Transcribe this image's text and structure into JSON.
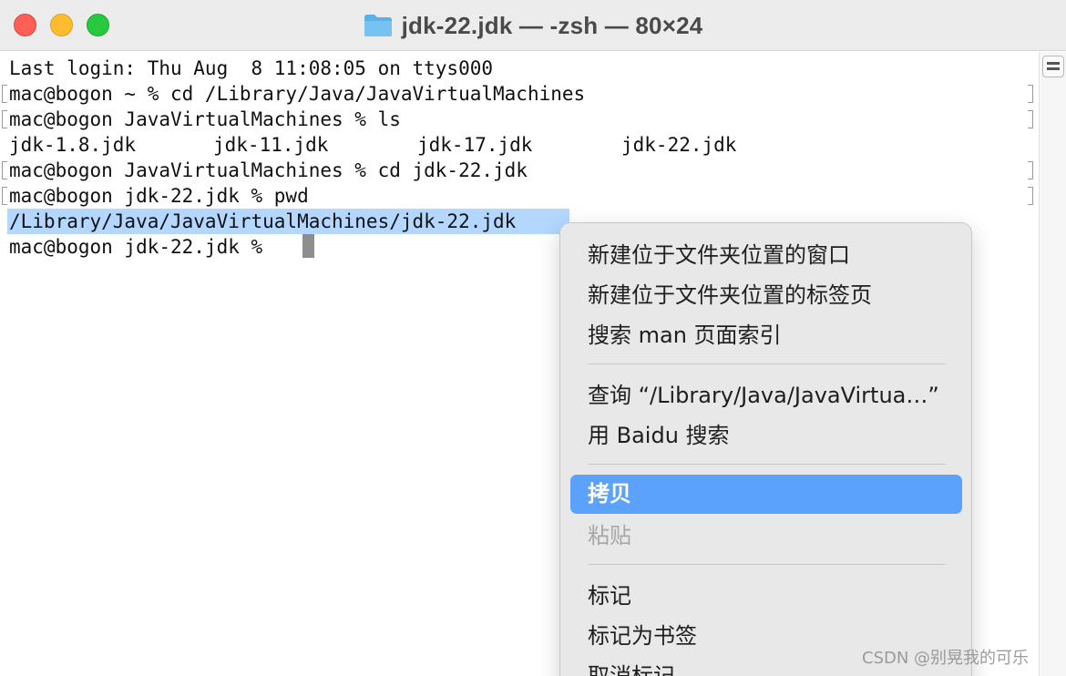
{
  "window": {
    "title": "jdk-22.jdk — -zsh — 80×24",
    "title_icon": "folder-icon",
    "traffic_lights": {
      "close": "#fe5f57",
      "minimize": "#febc2e",
      "maximize": "#28c840"
    }
  },
  "terminal": {
    "lines": [
      "Last login: Thu Aug  8 11:08:05 on ttys000",
      "mac@bogon ~ % cd /Library/Java/JavaVirtualMachines",
      "mac@bogon JavaVirtualMachines % ls",
      "mac@bogon JavaVirtualMachines % cd jdk-22.jdk",
      "mac@bogon jdk-22.jdk % pwd",
      "/Library/Java/JavaVirtualMachines/jdk-22.jdk",
      "mac@bogon jdk-22.jdk % "
    ],
    "ls_output": [
      "jdk-1.8.jdk",
      "jdk-11.jdk",
      "jdk-17.jdk",
      "jdk-22.jdk"
    ],
    "selection_color": "#b3d7ff"
  },
  "context_menu": {
    "items": [
      "新建位于文件夹位置的窗口",
      "新建位于文件夹位置的标签页",
      "搜索 man 页面索引",
      "查询 “/Library/Java/JavaVirtua…”",
      "用 Baidu 搜索",
      "拷贝",
      "粘贴",
      "标记",
      "标记为书签",
      "取消标记"
    ],
    "highlighted": "拷贝",
    "highlight_color": "#5aa2fb",
    "disabled": [
      "粘贴"
    ]
  },
  "watermark": "CSDN @别晃我的可乐"
}
